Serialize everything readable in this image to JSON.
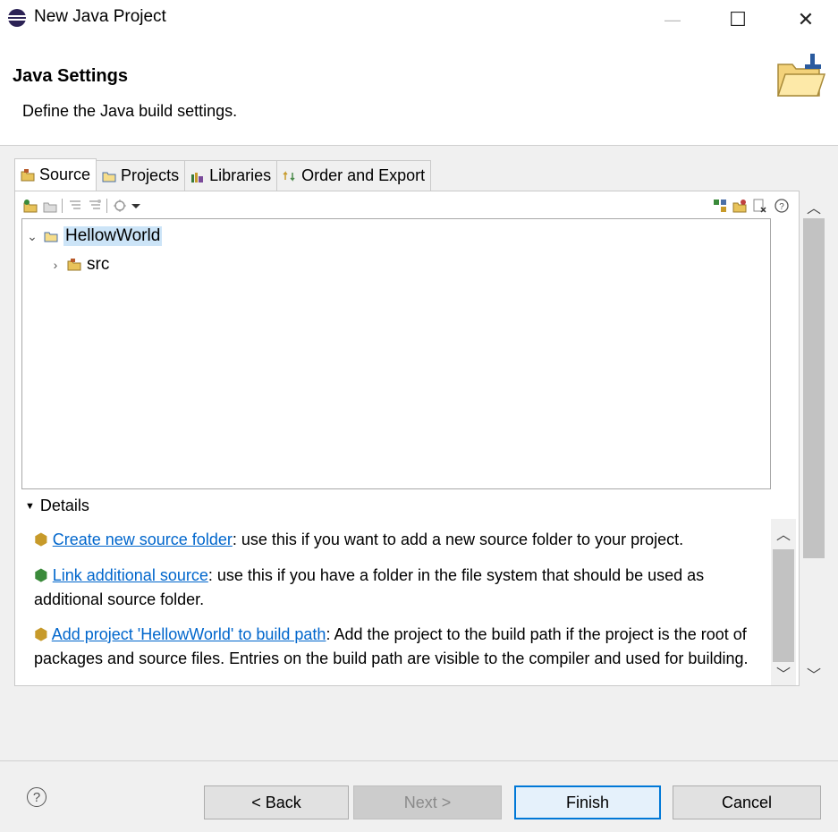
{
  "window": {
    "title": "New Java Project",
    "minimize_glyph": "—",
    "maximize_glyph": "☐",
    "close_glyph": "✕",
    "icon": "eclipse-icon"
  },
  "header": {
    "title": "Java Settings",
    "description": "Define the Java build settings.",
    "icon": "folder-wizard-icon"
  },
  "tabs": [
    {
      "label": "Source",
      "icon": "source-folder-icon",
      "active": true
    },
    {
      "label": "Projects",
      "icon": "projects-icon",
      "active": false
    },
    {
      "label": "Libraries",
      "icon": "libraries-icon",
      "active": false
    },
    {
      "label": "Order and Export",
      "icon": "order-export-icon",
      "active": false
    }
  ],
  "tree": {
    "root": {
      "label": "HellowWorld",
      "expanded": true,
      "selected": true
    },
    "children": [
      {
        "label": "src",
        "expanded": false
      }
    ]
  },
  "details": {
    "label": "Details",
    "items": [
      {
        "link": "Create new source folder",
        "text": ": use this if you want to add a new source folder to your project."
      },
      {
        "link": "Link additional source",
        "text": ": use this if you have a folder in the file system that should be used as additional source folder."
      },
      {
        "link": "Add project 'HellowWorld' to build path",
        "text": ": Add the project to the build path if the project is the root of packages and source files. Entries on the build path are visible to the compiler and used for building."
      }
    ]
  },
  "buttons": {
    "help": "?",
    "back": "< Back",
    "next": "Next >",
    "finish": "Finish",
    "cancel": "Cancel"
  },
  "colors": {
    "selection": "#cce4f7",
    "link": "#0066cc",
    "primary_border": "#0078d7"
  }
}
